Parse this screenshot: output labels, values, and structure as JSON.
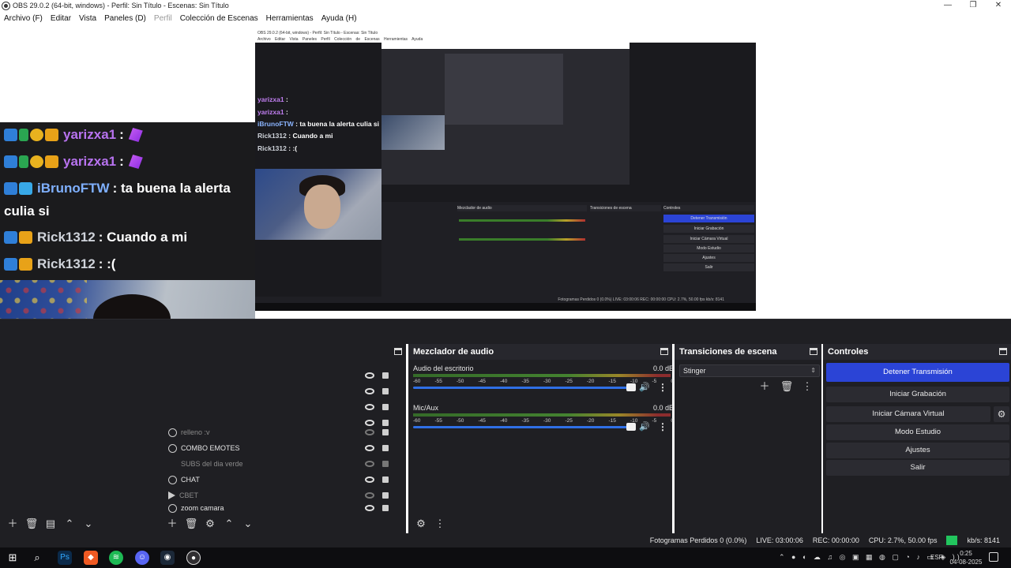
{
  "window": {
    "title": "OBS 29.0.2 (64-bit, windows) - Perfil: Sin Título - Escenas: Sin Título"
  },
  "menu": [
    "Archivo (F)",
    "Editar",
    "Vista",
    "Paneles (D)",
    "Perfil",
    "Colección de Escenas",
    "Herramientas",
    "Ayuda (H)"
  ],
  "nested_preview": {
    "chat": [
      {
        "user": "yarizxa1",
        "text": ":"
      },
      {
        "user": "yarizxa1",
        "text": ":"
      },
      {
        "user": "iBrunoFTW",
        "text": ": ta buena la alerta culia si"
      },
      {
        "user": "Rick1312",
        "text": ": Cuando a mi"
      },
      {
        "user": "Rick1312",
        "text": ": :("
      }
    ]
  },
  "chat": {
    "messages": [
      {
        "user": "yarizxa1",
        "text": ":"
      },
      {
        "user": "yarizxa1",
        "text": ":"
      },
      {
        "user": "iBrunoFTW",
        "text": ": ta buena la alerta",
        "cont": "culia si"
      },
      {
        "user": "Rick1312",
        "text": ": Cuando a mi"
      },
      {
        "user": "Rick1312",
        "text": ": :("
      }
    ]
  },
  "sources": {
    "items": [
      {
        "name": "relleno :v",
        "icon": "globe-icon"
      },
      {
        "name": "COMBO EMOTES",
        "icon": "globe-icon"
      },
      {
        "name": "SUBS del dia verde",
        "icon": "none"
      },
      {
        "name": "CHAT",
        "icon": "globe-icon"
      },
      {
        "name": "CBET",
        "icon": "play-icon"
      },
      {
        "name": "zoom camara",
        "icon": "globe-icon"
      }
    ]
  },
  "mixer": {
    "title": "Mezclador de audio",
    "channels": [
      {
        "name": "Audio del escritorio",
        "db": "0.0 dB"
      },
      {
        "name": "Mic/Aux",
        "db": "0.0 dB"
      }
    ],
    "scale": [
      "-60",
      "-55",
      "-50",
      "-45",
      "-40",
      "-35",
      "-30",
      "-25",
      "-20",
      "-15",
      "-10",
      "-5",
      "0"
    ]
  },
  "transitions": {
    "title": "Transiciones de escena",
    "selected": "Stinger"
  },
  "controls": {
    "title": "Controles",
    "stop_stream": "Detener Transmisión",
    "start_recording": "Iniciar Grabación",
    "start_virtual_cam": "Iniciar Cámara Virtual",
    "studio_mode": "Modo Estudio",
    "settings": "Ajustes",
    "exit": "Salir"
  },
  "status": {
    "dropped_frames": "Fotogramas Perdidos 0 (0.0%)",
    "live": "LIVE: 03:00:06",
    "rec": "REC: 00:00:00",
    "cpu": "CPU: 2.7%, 50.00 fps",
    "bitrate": "kb/s: 8141"
  },
  "taskbar": {
    "lang": "ESP",
    "time": "0:25",
    "date": "04-08-2025"
  },
  "colors": {
    "accent": "#2b44d6",
    "dock_bg": "#1f1f23",
    "status_ok": "#22c55e"
  }
}
